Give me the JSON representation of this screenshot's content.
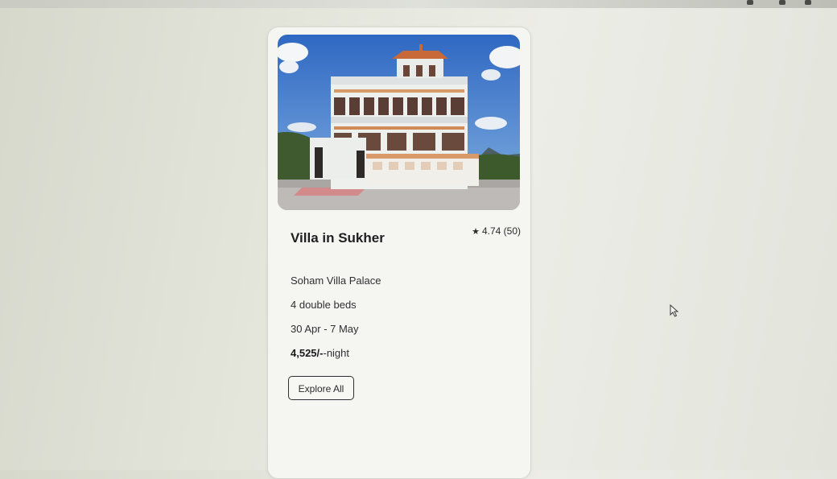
{
  "listing": {
    "title": "Villa in Sukher",
    "rating": "4.74",
    "reviews": "(50)",
    "property_name": "Soham Villa Palace",
    "beds": "4 double beds",
    "dates": "30 Apr - 7 May",
    "price_amount": "4,525/-",
    "price_unit": "night",
    "cta_label": "Explore All"
  },
  "icons": {
    "rating": "star-icon",
    "pointer": "mouse-cursor-icon"
  },
  "colors": {
    "sky": "#3f78c9",
    "building": "#eef0ee",
    "accent": "#c97a3a"
  }
}
